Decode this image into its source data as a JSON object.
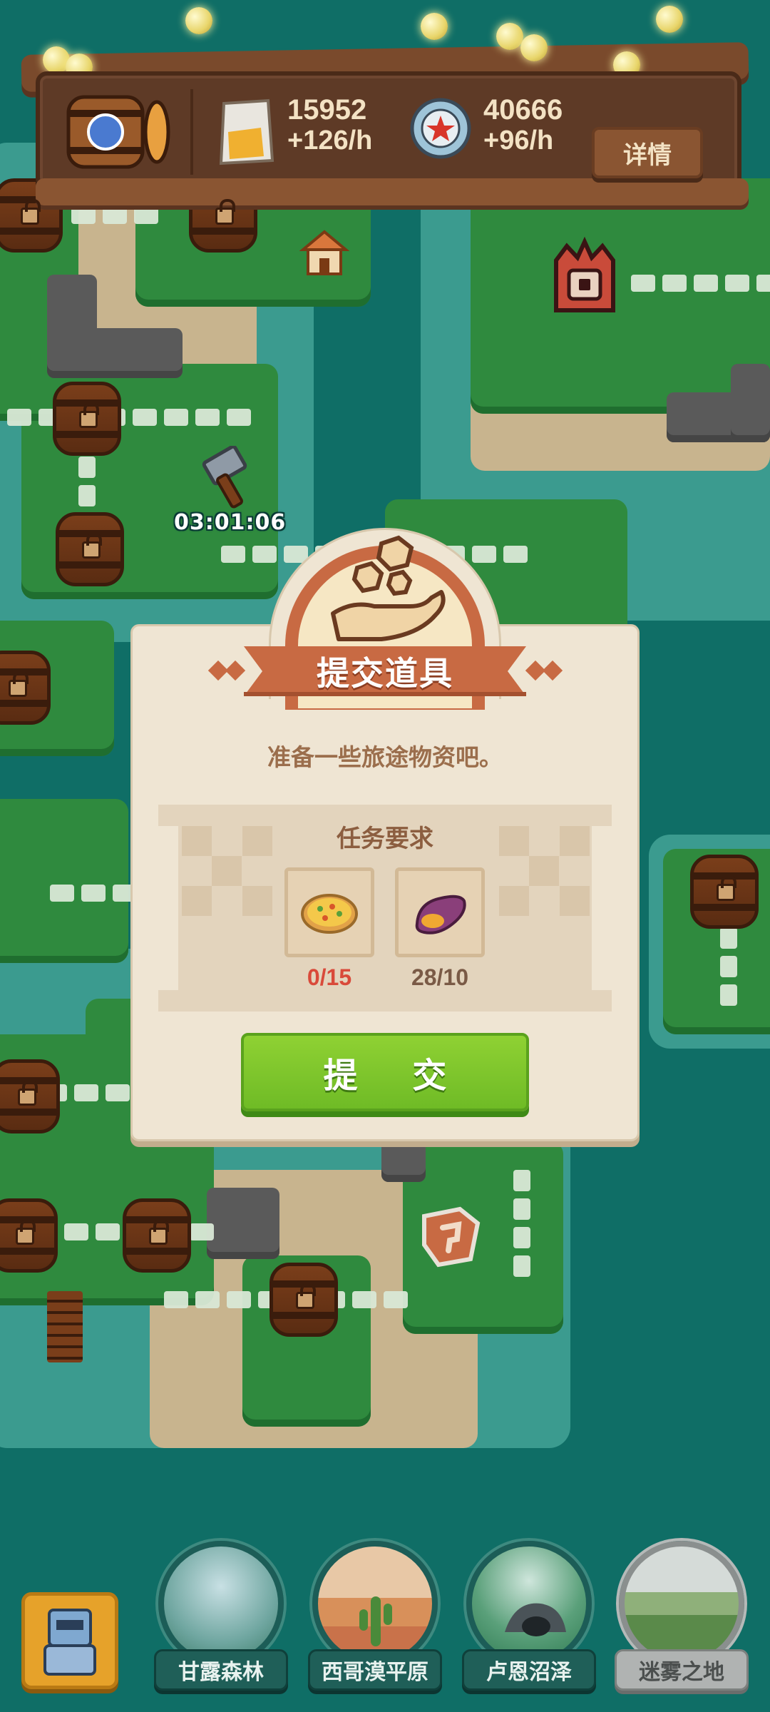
{
  "resources": {
    "beer": {
      "icon": "beer-barrel-icon"
    },
    "chips": {
      "icon": "snack-bag-icon",
      "amount": "15952",
      "rate": "+126/h"
    },
    "caps": {
      "icon": "bottle-cap-icon",
      "amount": "40666",
      "rate": "+96/h"
    },
    "details_label": "详情"
  },
  "map": {
    "timer": "03:01:06"
  },
  "dialog": {
    "title": "提交道具",
    "subtitle": "准备一些旅途物资吧。",
    "requirements_title": "任务要求",
    "items": [
      {
        "icon": "pizza-icon",
        "count": "0/15",
        "status_color": "#d94a3a"
      },
      {
        "icon": "sweet-potato-icon",
        "count": "28/10",
        "status_color": "#7a5a46"
      }
    ],
    "submit_label": "提 交"
  },
  "regions": [
    {
      "label": "甘露森林",
      "locked": false
    },
    {
      "label": "西哥漠平原",
      "locked": false
    },
    {
      "label": "卢恩沼泽",
      "locked": false
    },
    {
      "label": "迷雾之地",
      "locked": true
    }
  ],
  "colors": {
    "water": "#0f6e66",
    "grass": "#2f8a3e",
    "wood": "#5e3a26",
    "dialog_bg": "#efe5d3",
    "accent": "#c86a43",
    "submit": "#7fc52a"
  }
}
